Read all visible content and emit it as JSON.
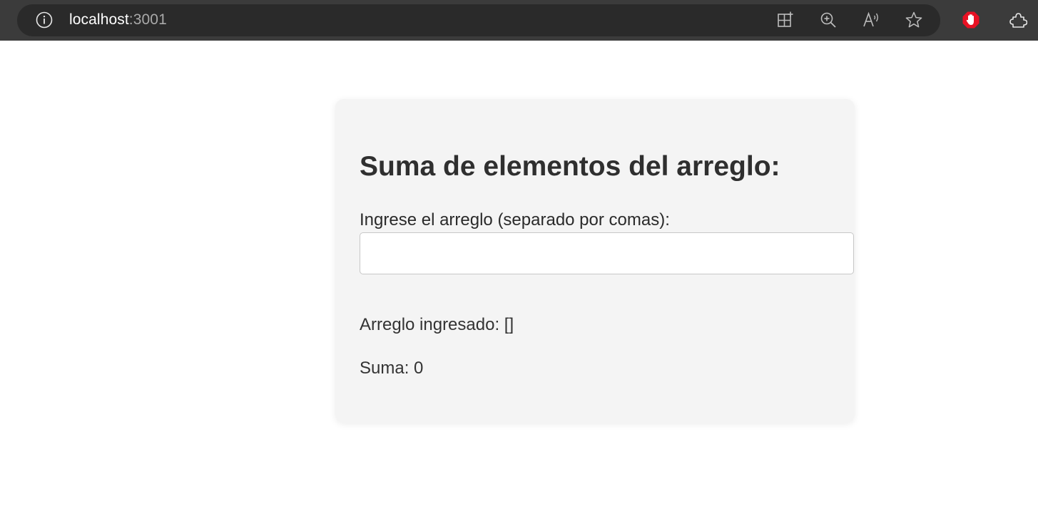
{
  "browser": {
    "url_host": "localhost",
    "url_port": ":3001",
    "icons": [
      "info-icon",
      "split-screen-icon",
      "zoom-in-icon",
      "read-aloud-icon",
      "favorite-star-icon",
      "ad-block-icon",
      "extensions-icon"
    ],
    "colors": {
      "toolbar_bg": "#3b3b3b",
      "address_bg": "#2a2a2a",
      "ad_block_red": "#e81123"
    }
  },
  "card": {
    "title": "Suma de elementos del arreglo:",
    "input_label": "Ingrese el arreglo (separado por comas):",
    "input_value": "",
    "input_placeholder": "",
    "array_label": "Arreglo ingresado:",
    "array_value": "[]",
    "sum_label": "Suma:",
    "sum_value": "0"
  }
}
